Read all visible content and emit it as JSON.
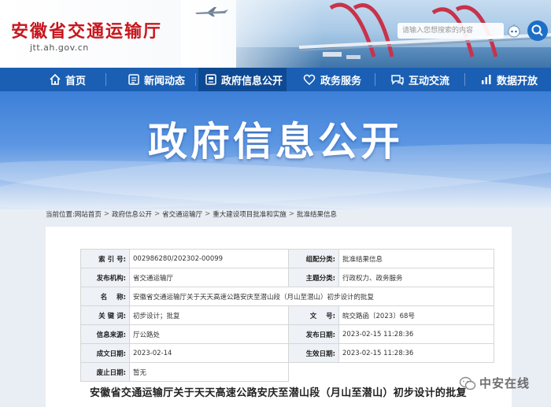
{
  "header": {
    "site_title": "安徽省交通运输厅",
    "site_url": "jtt.ah.gov.cn",
    "search_placeholder": "请输入您想搜索的内容"
  },
  "nav": {
    "items": [
      {
        "label": "首页",
        "icon": "home-icon"
      },
      {
        "label": "新闻动态",
        "icon": "news-icon"
      },
      {
        "label": "政府信息公开",
        "icon": "info-disclosure-icon",
        "active": true
      },
      {
        "label": "政务服务",
        "icon": "heart-hand-icon"
      },
      {
        "label": "互动交流",
        "icon": "chat-icon"
      },
      {
        "label": "数据开放",
        "icon": "bar-chart-icon"
      }
    ]
  },
  "hero": {
    "title": "政府信息公开"
  },
  "breadcrumb": {
    "prefix": "当前位置:",
    "items": [
      "网站首页",
      "政府信息公开",
      "省交通运输厅",
      "重大建设项目批准和实施",
      "批准结果信息"
    ]
  },
  "meta": {
    "index_label": "索 引 号:",
    "index_value": "002986280/202302-00099",
    "category_label": "组配分类:",
    "category_value": "批准结果信息",
    "publisher_label": "发布机构:",
    "publisher_value": "省交通运输厅",
    "topic_label": "主题分类:",
    "topic_value": "行政权力、政务服务",
    "name_label": "名    称:",
    "name_value": "安徽省交通运输厅关于天天高速公路安庆至潜山段（月山至潜山）初步设计的批复",
    "keywords_label": "关 键 词:",
    "keywords_value": "初步设计；批复",
    "docno_label": "文    号:",
    "docno_value": "皖交路函〔2023〕68号",
    "source_label": "信息来源:",
    "source_value": "厅公路处",
    "pubdate_label": "发布日期:",
    "pubdate_value": "2023-02-15 11:28:36",
    "created_label": "成文日期:",
    "created_value": "2023-02-14",
    "effective_label": "生效日期:",
    "effective_value": "2023-02-15 11:28:36",
    "abolish_label": "废止日期:",
    "abolish_value": "暂无"
  },
  "document": {
    "title": "安徽省交通运输厅关于天天高速公路安庆至潜山段（月山至潜山）初步设计的批复"
  },
  "watermark": {
    "text": "中安在线"
  },
  "colors": {
    "brand_red": "#c8161d",
    "nav_blue": "#1a5fb3",
    "nav_active": "#0e4a93"
  }
}
